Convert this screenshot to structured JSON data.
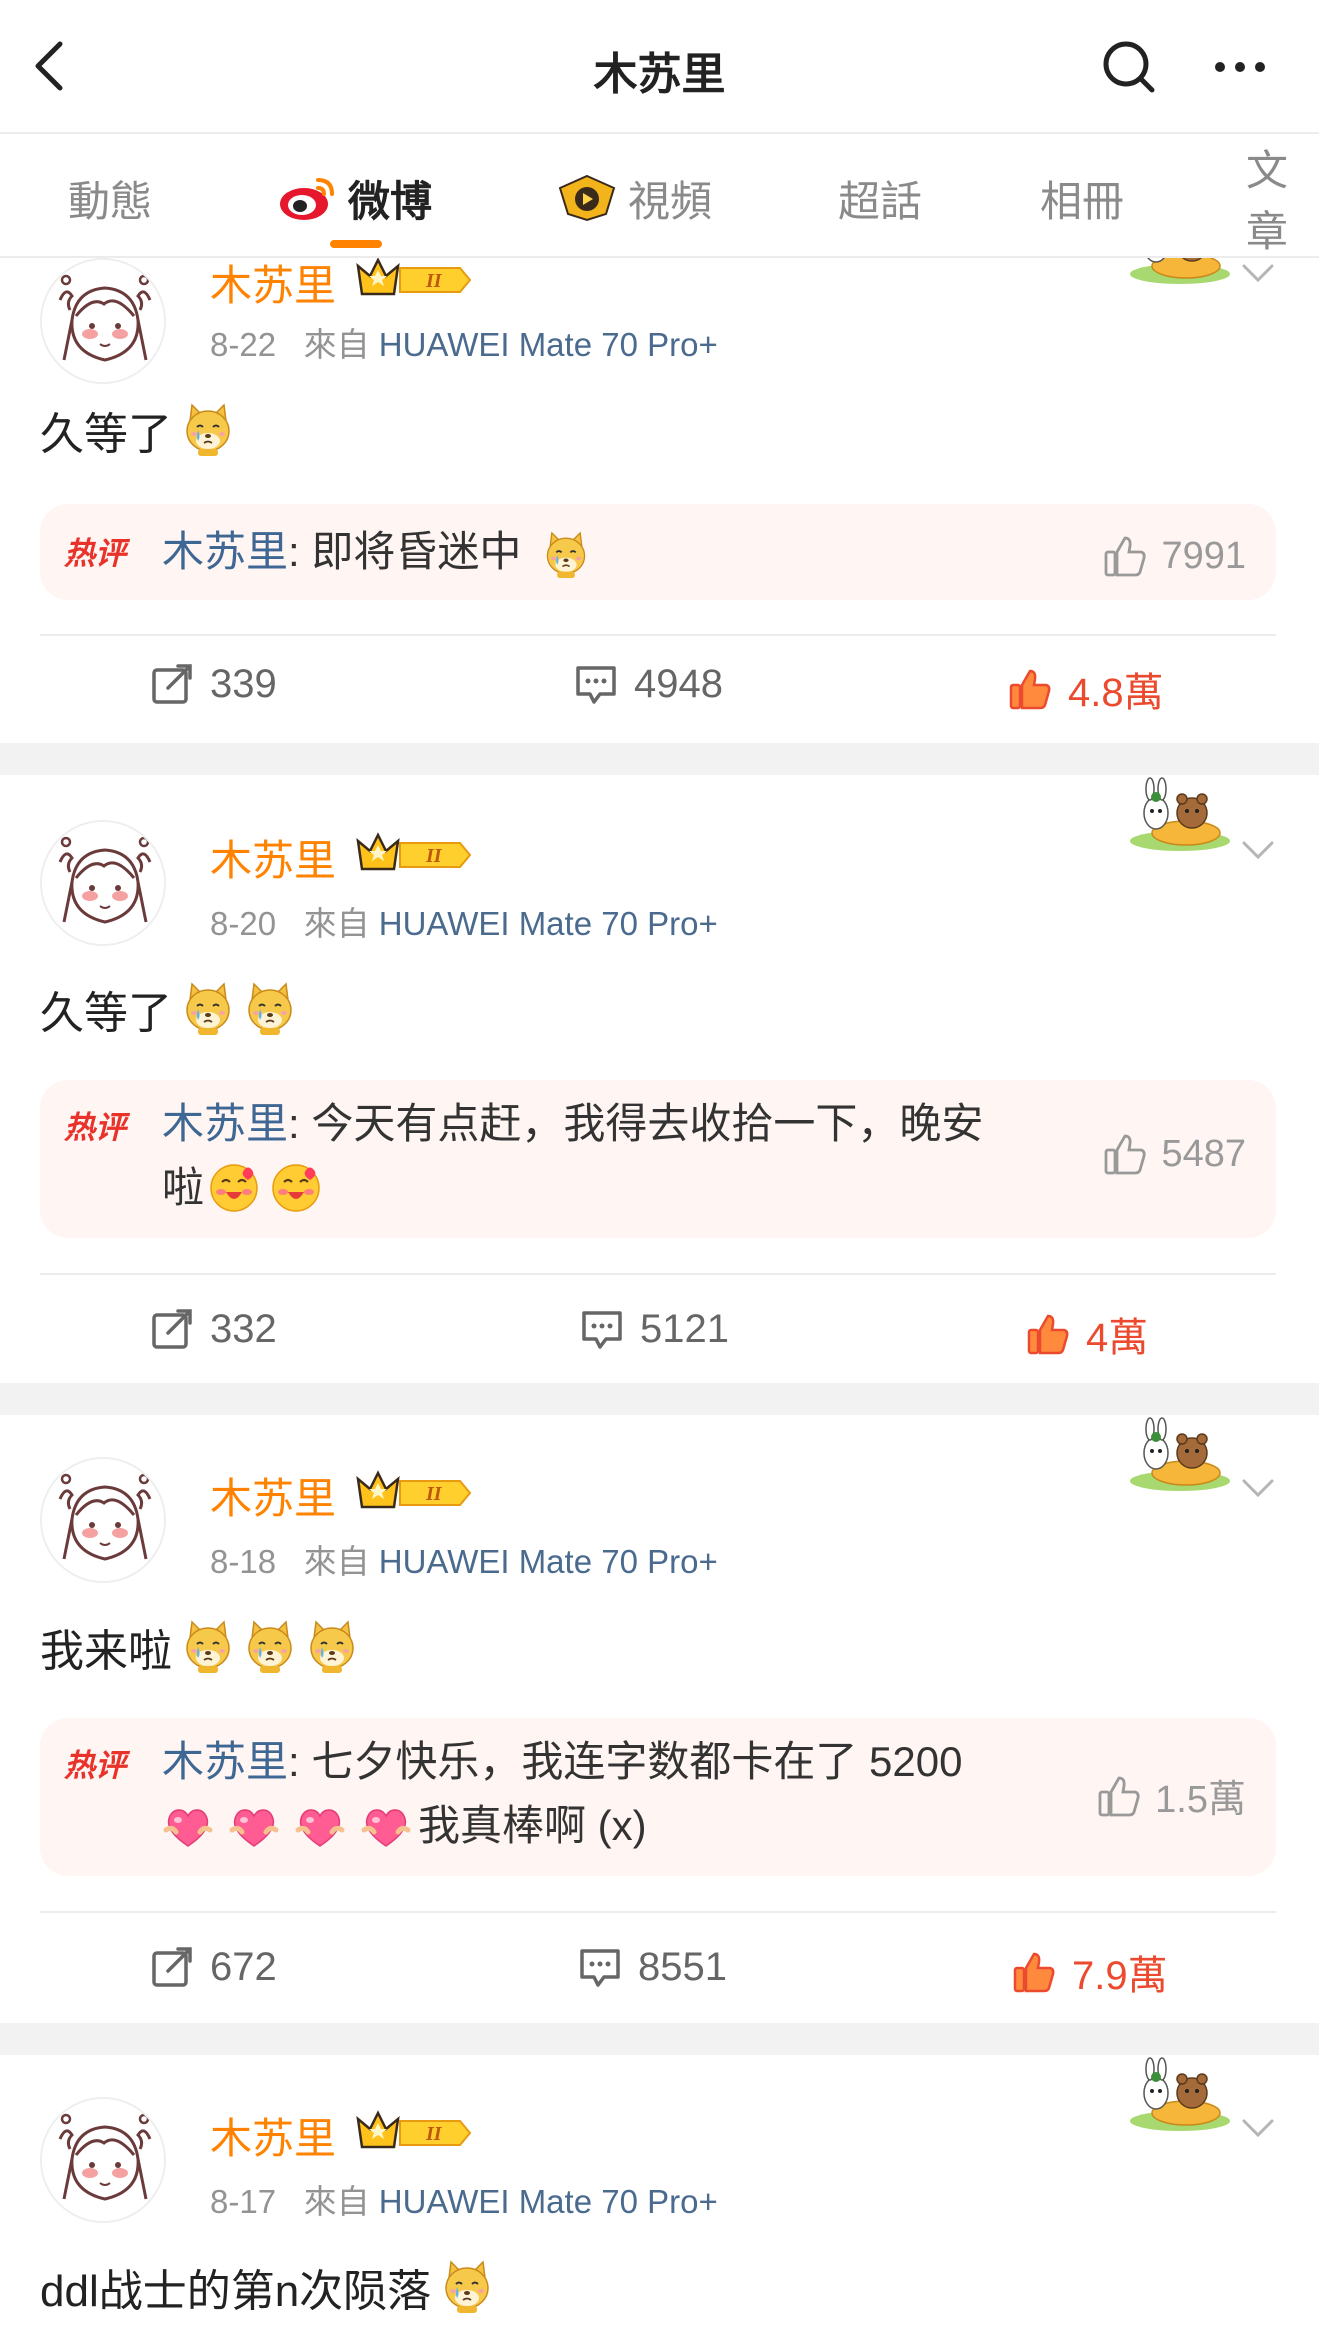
{
  "header": {
    "title": "木苏里"
  },
  "tabs": [
    "動態",
    "微博",
    "視頻",
    "超話",
    "相冊",
    "文章"
  ],
  "colors": {
    "accent": "#ff8200",
    "link": "#3f6794",
    "like_red": "#eb4a2e",
    "hot_bg": "#fff5f3"
  },
  "posts": [
    {
      "username": "木苏里",
      "date": "8-22",
      "source_prefix": "來自",
      "source": "HUAWEI Mate 70 Pro+",
      "text": "久等了",
      "emojis": [
        "dog-tear-emoji"
      ],
      "hot_label": "热评",
      "hot_user": "木苏里",
      "hot_line1": ": 即将昏迷中",
      "hot_line2": "",
      "hot_likes": "7991",
      "reposts": "339",
      "comments": "4948",
      "likes": "4.8萬"
    },
    {
      "username": "木苏里",
      "date": "8-20",
      "source_prefix": "來自",
      "source": "HUAWEI Mate 70 Pro+",
      "text": "久等了",
      "emojis": [
        "dog-tear-emoji",
        "dog-tear-emoji"
      ],
      "hot_label": "热评",
      "hot_user": "木苏里",
      "hot_line1": ": 今天有点赶，我得去收拾一下，晚安",
      "hot_line2": "啦",
      "hot_likes": "5487",
      "reposts": "332",
      "comments": "5121",
      "likes": "4萬"
    },
    {
      "username": "木苏里",
      "date": "8-18",
      "source_prefix": "來自",
      "source": "HUAWEI Mate 70 Pro+",
      "text": "我来啦",
      "emojis": [
        "dog-tear-emoji",
        "dog-tear-emoji",
        "dog-tear-emoji"
      ],
      "hot_label": "热评",
      "hot_user": "木苏里",
      "hot_line1": ": 七夕快乐，我连字数都卡在了 5200",
      "hot_line2": "我真棒啊 (x)",
      "hot_likes": "1.5萬",
      "reposts": "672",
      "comments": "8551",
      "likes": "7.9萬"
    },
    {
      "username": "木苏里",
      "date": "8-17",
      "source_prefix": "來自",
      "source": "HUAWEI Mate 70 Pro+",
      "text": "ddl战士的第n次陨落",
      "emojis": [
        "dog-tear-emoji"
      ]
    }
  ]
}
